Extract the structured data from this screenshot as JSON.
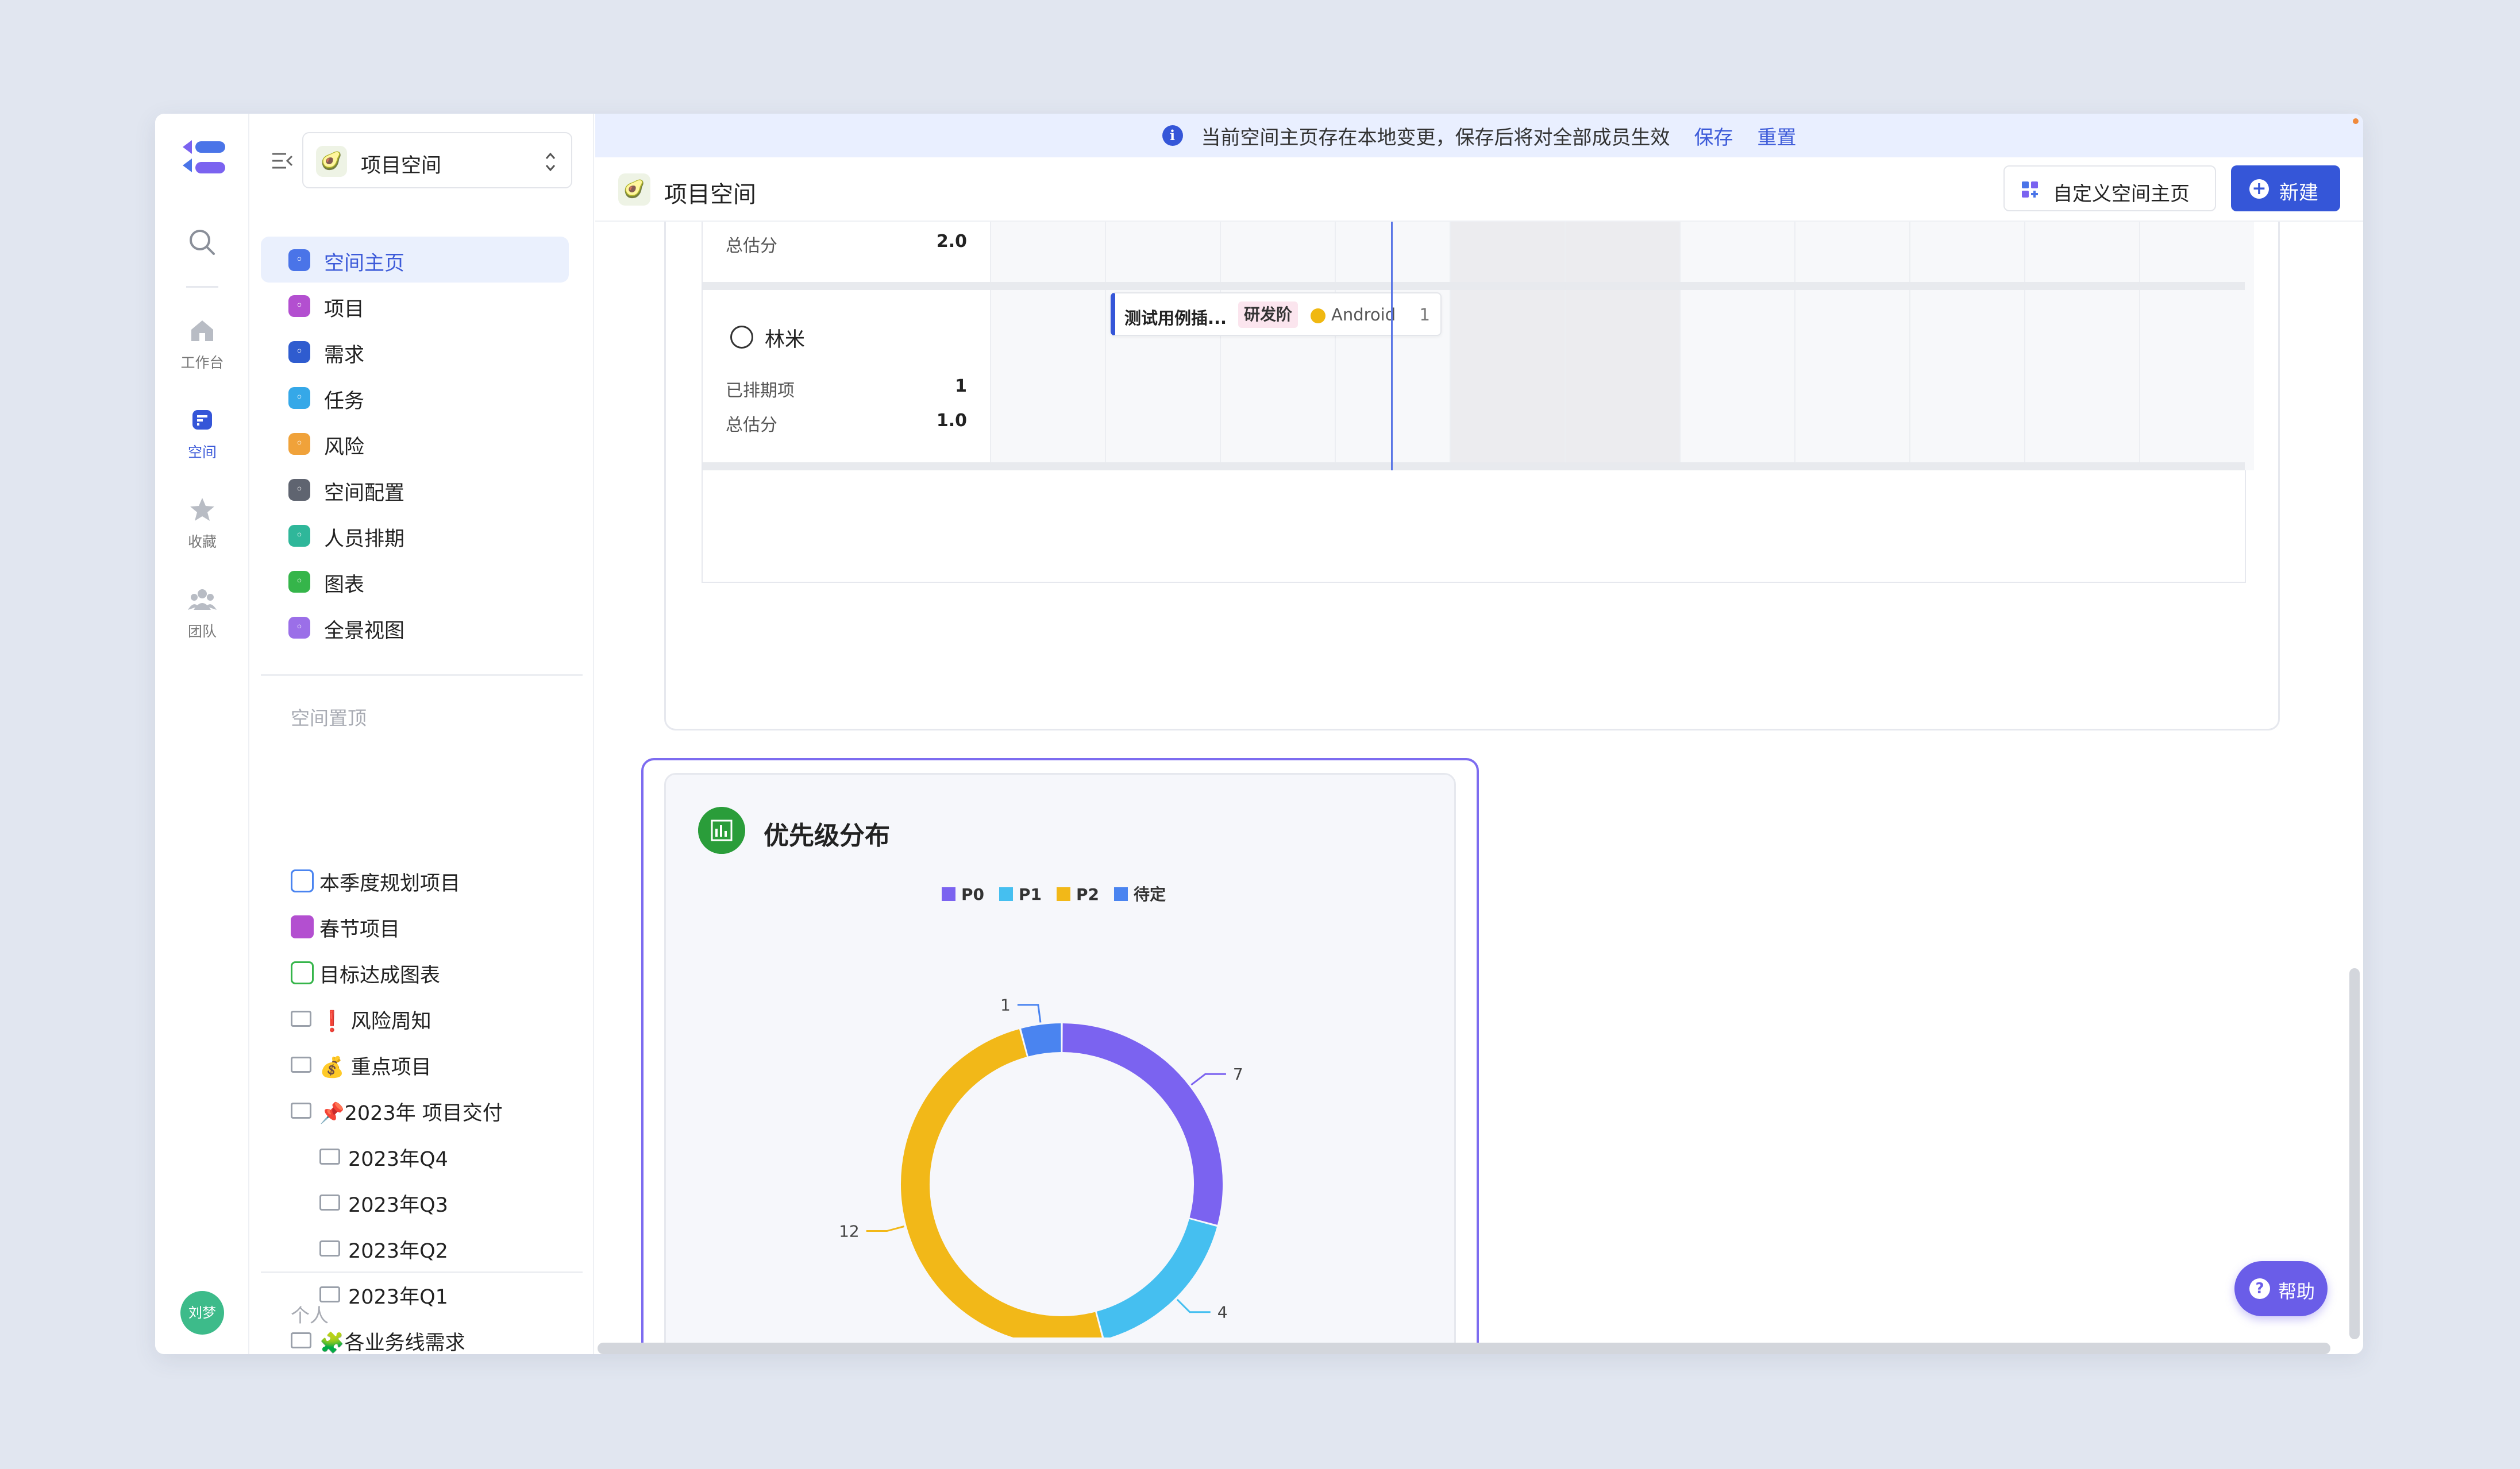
{
  "colors": {
    "accent": "#3556d8",
    "chart_border": "#7d6cf0",
    "help": "#6a5de8"
  },
  "rail": {
    "items": [
      {
        "label": "工作台",
        "icon": "home-icon"
      },
      {
        "label": "空间",
        "icon": "space-icon",
        "active": true
      },
      {
        "label": "收藏",
        "icon": "star-icon"
      },
      {
        "label": "团队",
        "icon": "team-icon"
      }
    ],
    "avatar": "刘梦"
  },
  "sidebar": {
    "space_name": "项目空间",
    "nav": [
      {
        "label": "空间主页",
        "color": "#4a74e8",
        "active": true
      },
      {
        "label": "项目",
        "color": "#b34fd0"
      },
      {
        "label": "需求",
        "color": "#2f5ccf"
      },
      {
        "label": "任务",
        "color": "#35a8e8"
      },
      {
        "label": "风险",
        "color": "#f0a23a"
      },
      {
        "label": "空间配置",
        "color": "#5f6470"
      },
      {
        "label": "人员排期",
        "color": "#2fb79a"
      },
      {
        "label": "图表",
        "color": "#35b54a"
      },
      {
        "label": "全景视图",
        "color": "#9b6fe8"
      }
    ],
    "pinned_title": "空间置顶",
    "pinned": [
      {
        "label": "本季度规划项目",
        "icon": "list-icon",
        "indent": 0
      },
      {
        "label": "春节项目",
        "icon": "project-icon",
        "indent": 0
      },
      {
        "label": "目标达成图表",
        "icon": "list-green-icon",
        "indent": 0
      },
      {
        "label": "❗ 风险周知",
        "icon": "folder-icon",
        "indent": 0
      },
      {
        "label": "💰 重点项目",
        "icon": "folder-icon",
        "indent": 0
      },
      {
        "label": "📌2023年 项目交付",
        "icon": "folder-icon",
        "indent": 0
      },
      {
        "label": "2023年Q4",
        "icon": "folder-icon",
        "indent": 1
      },
      {
        "label": "2023年Q3",
        "icon": "folder-icon",
        "indent": 1
      },
      {
        "label": "2023年Q2",
        "icon": "folder-icon",
        "indent": 1
      },
      {
        "label": "2023年Q1",
        "icon": "folder-icon",
        "indent": 1
      },
      {
        "label": "🧩各业务线需求",
        "icon": "folder-icon",
        "indent": 0
      }
    ],
    "personal_title": "个人"
  },
  "banner": {
    "text": "当前空间主页存在本地变更，保存后将对全部成员生效",
    "save": "保存",
    "reset": "重置"
  },
  "header": {
    "title": "项目空间",
    "custom_button": "自定义空间主页",
    "new_button": "新建"
  },
  "schedule": {
    "row1": {
      "total_label": "总估分",
      "total_value": "2.0"
    },
    "row2": {
      "name": "林米",
      "scheduled_label": "已排期项",
      "scheduled_value": "1",
      "total_label": "总估分",
      "total_value": "1.0"
    },
    "task": {
      "title": "测试用例插...",
      "stage": "研发阶",
      "platform": "Android",
      "count": "1"
    }
  },
  "chart_card": {
    "title": "优先级分布"
  },
  "chart_data": {
    "type": "pie",
    "donut": true,
    "legend_position": "top",
    "categories": [
      "P0",
      "P1",
      "P2",
      "待定"
    ],
    "values": [
      7,
      4,
      12,
      1
    ],
    "colors": [
      "#7b63f0",
      "#45bff0",
      "#f2b818",
      "#4a84f0"
    ]
  },
  "help": {
    "label": "帮助"
  }
}
